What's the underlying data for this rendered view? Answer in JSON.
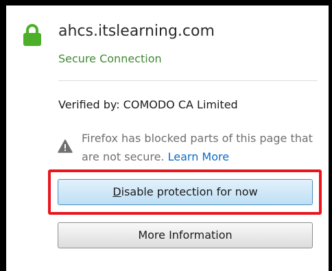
{
  "identity_panel": {
    "host": "ahcs.itslearning.com",
    "connection_status": "Secure Connection",
    "verified_by": "Verified by: COMODO CA Limited",
    "mixed_content_warning": "Firefox has blocked parts of this page that are not secure.",
    "learn_more_label": "Learn More",
    "disable_protection_button": {
      "accesskey_letter": "D",
      "label_rest": "isable protection for now"
    },
    "more_information_button_label": "More Information"
  },
  "colors": {
    "secure_green": "#418834",
    "link_blue": "#0a6ac7",
    "highlight_red": "#e8151d",
    "lock_green": "#4caf2a"
  },
  "icons": {
    "lock": "lock-icon",
    "warning": "warning-triangle-icon"
  }
}
